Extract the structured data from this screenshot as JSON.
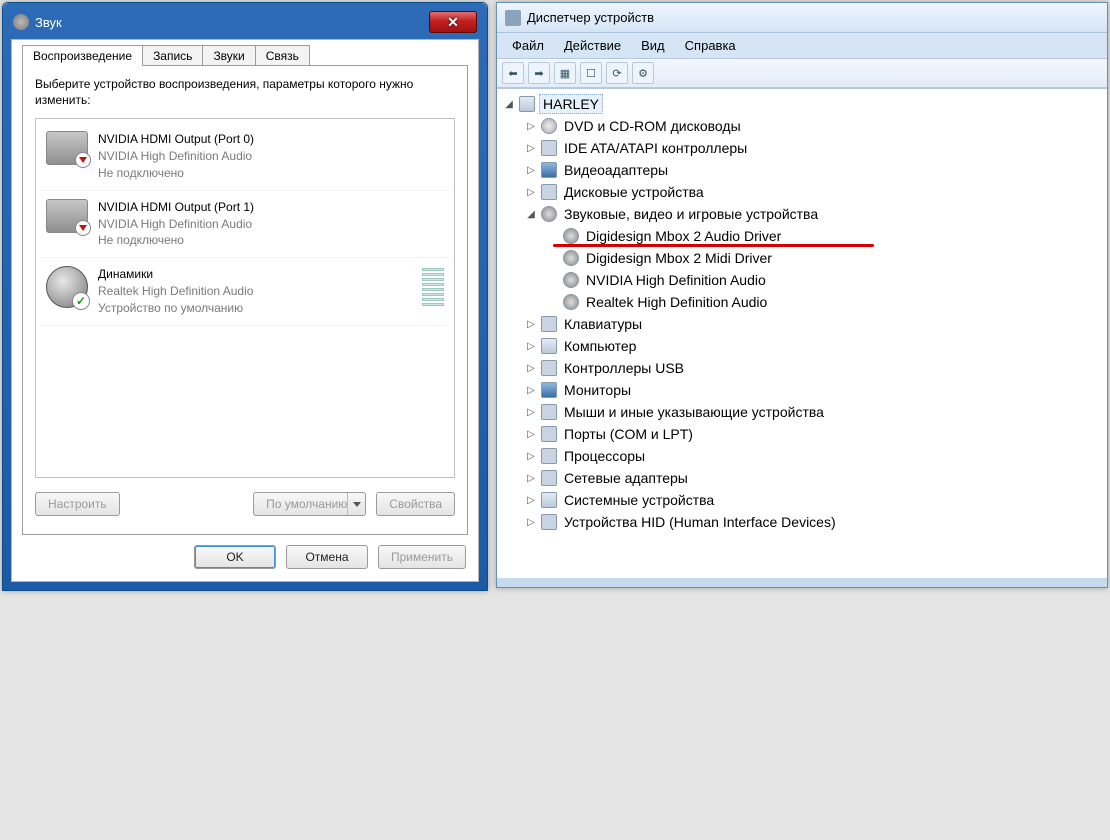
{
  "sound": {
    "title": "Звук",
    "tabs": [
      "Воспроизведение",
      "Запись",
      "Звуки",
      "Связь"
    ],
    "active_tab": 0,
    "instruction": "Выберите устройство воспроизведения, параметры которого нужно изменить:",
    "devices": [
      {
        "name": "NVIDIA HDMI Output (Port 0)",
        "driver": "NVIDIA High Definition Audio",
        "status": "Не подключено",
        "state": "disconnected"
      },
      {
        "name": "NVIDIA HDMI Output (Port 1)",
        "driver": "NVIDIA High Definition Audio",
        "status": "Не подключено",
        "state": "disconnected"
      },
      {
        "name": "Динамики",
        "driver": "Realtek High Definition Audio",
        "status": "Устройство по умолчанию",
        "state": "default"
      }
    ],
    "buttons": {
      "configure": "Настроить",
      "set_default": "По умолчанию",
      "properties": "Свойства",
      "ok": "OK",
      "cancel": "Отмена",
      "apply": "Применить"
    }
  },
  "devmgr": {
    "title": "Диспетчер устройств",
    "menu": [
      "Файл",
      "Действие",
      "Вид",
      "Справка"
    ],
    "root": "HARLEY",
    "categories": [
      {
        "label": "DVD и CD-ROM дисководы",
        "icon": "disc",
        "expanded": false
      },
      {
        "label": "IDE ATA/ATAPI контроллеры",
        "icon": "gen",
        "expanded": false
      },
      {
        "label": "Видеоадаптеры",
        "icon": "mon",
        "expanded": false
      },
      {
        "label": "Дисковые устройства",
        "icon": "gen",
        "expanded": false
      },
      {
        "label": "Звуковые, видео и игровые устройства",
        "icon": "snd",
        "expanded": true,
        "children": [
          "Digidesign Mbox 2 Audio Driver",
          "Digidesign Mbox 2 Midi Driver",
          "NVIDIA High Definition Audio",
          "Realtek High Definition Audio"
        ],
        "highlight_index": 0
      },
      {
        "label": "Клавиатуры",
        "icon": "gen",
        "expanded": false
      },
      {
        "label": "Компьютер",
        "icon": "comp",
        "expanded": false
      },
      {
        "label": "Контроллеры USB",
        "icon": "gen",
        "expanded": false
      },
      {
        "label": "Мониторы",
        "icon": "mon",
        "expanded": false
      },
      {
        "label": "Мыши и иные указывающие устройства",
        "icon": "gen",
        "expanded": false
      },
      {
        "label": "Порты (COM и LPT)",
        "icon": "gen",
        "expanded": false
      },
      {
        "label": "Процессоры",
        "icon": "gen",
        "expanded": false
      },
      {
        "label": "Сетевые адаптеры",
        "icon": "gen",
        "expanded": false
      },
      {
        "label": "Системные устройства",
        "icon": "comp",
        "expanded": false
      },
      {
        "label": "Устройства HID (Human Interface Devices)",
        "icon": "gen",
        "expanded": false
      }
    ]
  }
}
